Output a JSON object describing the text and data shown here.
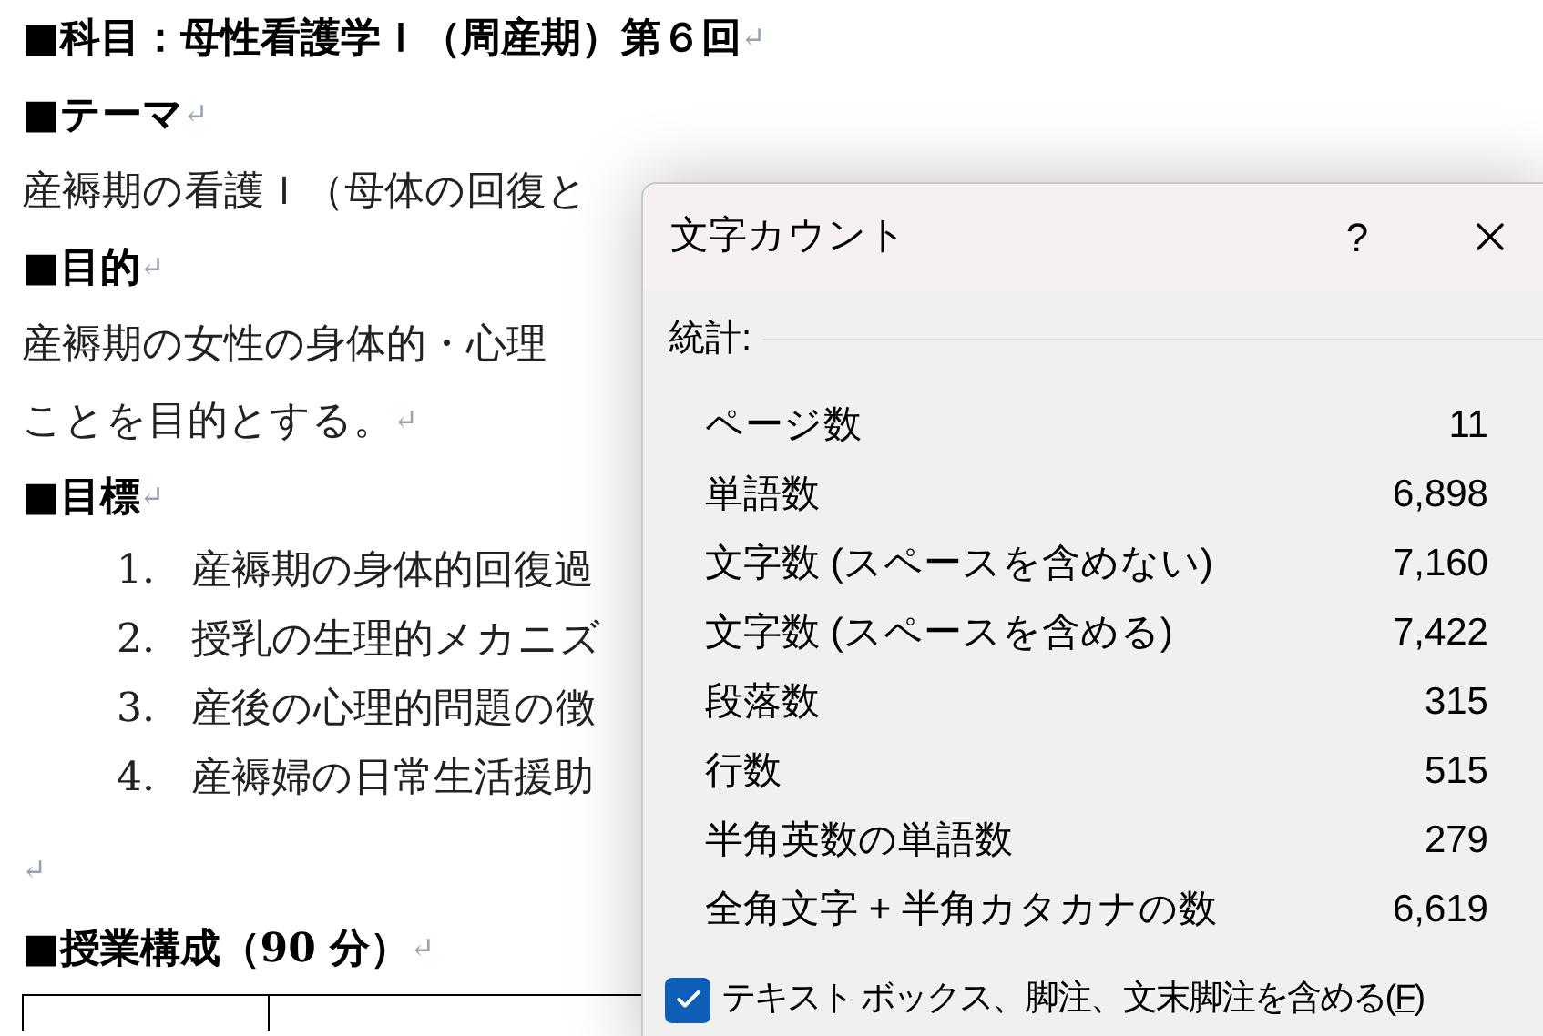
{
  "document": {
    "lines": [
      {
        "kind": "heading",
        "text": "■科目：母性看護学Ｉ（周産期）第６回",
        "mark": "↵"
      },
      {
        "kind": "heading",
        "text": "■テーマ",
        "mark": "↵"
      },
      {
        "kind": "body",
        "text": "産褥期の看護Ｉ（母体の回復と"
      },
      {
        "kind": "heading",
        "text": "■目的",
        "mark": "↵"
      },
      {
        "kind": "body",
        "text": "産褥期の女性の身体的・心理"
      },
      {
        "kind": "body",
        "text": "ことを目的とする。",
        "mark": "↵"
      },
      {
        "kind": "heading",
        "text": "■目標",
        "mark": "↵"
      },
      {
        "kind": "item",
        "number": "1.",
        "text": "産褥期の身体的回復過"
      },
      {
        "kind": "item",
        "number": "2.",
        "text": "授乳の生理的メカニズ"
      },
      {
        "kind": "item",
        "number": "3.",
        "text": "産後の心理的問題の徴"
      },
      {
        "kind": "item",
        "number": "4.",
        "text": "産褥婦の日常生活援助"
      },
      {
        "kind": "empty",
        "mark": "↵"
      },
      {
        "kind": "heading",
        "text": "■授業構成（90 分）",
        "mark": "↵"
      }
    ]
  },
  "dialog": {
    "title": "文字カウント",
    "help": "?",
    "section": "統計:",
    "stats": [
      {
        "label": "ページ数",
        "value": "11"
      },
      {
        "label": "単語数",
        "value": "6,898"
      },
      {
        "label": "文字数 (スペースを含めない)",
        "value": "7,160"
      },
      {
        "label": "文字数 (スペースを含める)",
        "value": "7,422"
      },
      {
        "label": "段落数",
        "value": "315"
      },
      {
        "label": "行数",
        "value": "515"
      },
      {
        "label": "半角英数の単語数",
        "value": "279"
      },
      {
        "label": "全角文字 + 半角カタカナの数",
        "value": "6,619"
      }
    ],
    "checkbox": {
      "label": "テキスト ボックス、脚注、文末脚注を含める(",
      "accel": "F",
      "close": ")",
      "checked": true
    }
  }
}
